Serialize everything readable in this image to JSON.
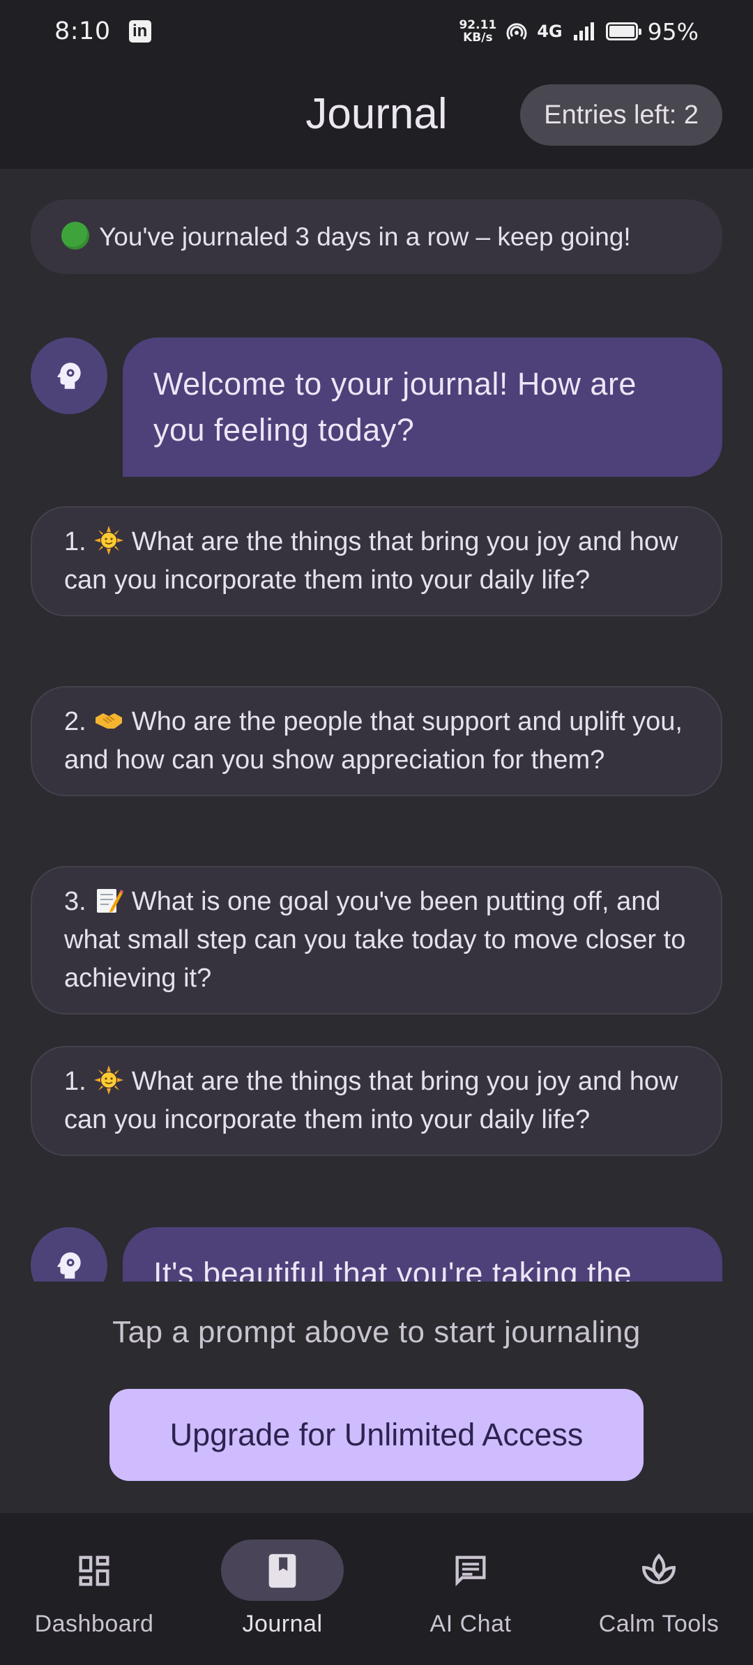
{
  "status_bar": {
    "time": "8:10",
    "net_speed_value": "92.11",
    "net_speed_unit": "KB/s",
    "network": "4G",
    "battery": "95%"
  },
  "header": {
    "title": "Journal",
    "entries_left": "Entries left: 2"
  },
  "chat": {
    "streak": "You've journaled 3 days in a row – keep going!",
    "welcome": "Welcome to your journal! How are you feeling today?",
    "prompts": [
      "What are the things that bring you joy and how can you incorporate them into your daily life?",
      "Who are the people that support and uplift you, and how can you show appreciation for them?",
      "What is one goal you've been putting off, and what small step can you take today to move closer to achieving it?",
      "What are the things that bring you joy and how can you incorporate them into your daily life?"
    ],
    "prompt_numbers": [
      "1.",
      "2.",
      "3.",
      "1."
    ],
    "bot_reply_partial": "It's beautiful that you're taking the"
  },
  "footer": {
    "hint": "Tap a prompt above to start journaling",
    "upgrade_label": "Upgrade for Unlimited Access"
  },
  "nav": {
    "items": [
      {
        "label": "Dashboard",
        "icon": "dashboard-icon"
      },
      {
        "label": "Journal",
        "icon": "journal-icon",
        "active": true
      },
      {
        "label": "AI Chat",
        "icon": "chat-icon"
      },
      {
        "label": "Calm Tools",
        "icon": "spa-icon"
      }
    ]
  },
  "colors": {
    "background": "#2b2b30",
    "bar": "#1f1f24",
    "bot_bubble": "#4e4079",
    "prompt_card": "#36333f",
    "accent": "#cfbcff"
  }
}
